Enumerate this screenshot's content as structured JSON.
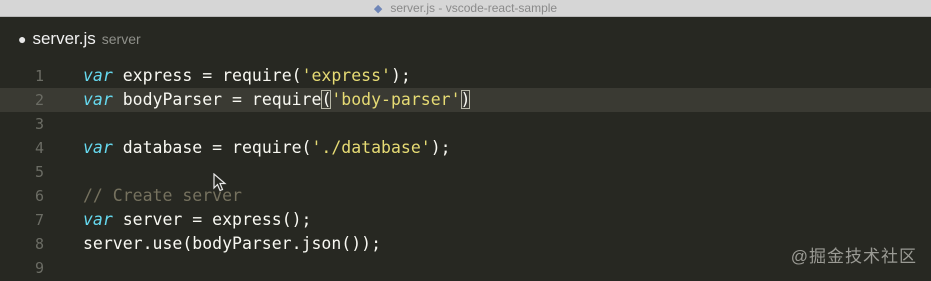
{
  "window": {
    "title": "server.js - vscode-react-sample"
  },
  "tab": {
    "dirty_indicator": "●",
    "filename": "server.js",
    "folder": "server"
  },
  "editor": {
    "lines": [
      {
        "number": "1",
        "tokens": [
          [
            "kw",
            "var"
          ],
          [
            "plain",
            " express = require("
          ],
          [
            "str",
            "'express'"
          ],
          [
            "plain",
            ");"
          ]
        ]
      },
      {
        "number": "2",
        "current": true,
        "tokens": [
          [
            "kw",
            "var"
          ],
          [
            "plain",
            " bodyParser = require"
          ],
          [
            "bracket",
            "("
          ],
          [
            "str",
            "'body-parser'"
          ],
          [
            "bracket",
            ")"
          ]
        ]
      },
      {
        "number": "3",
        "tokens": []
      },
      {
        "number": "4",
        "tokens": [
          [
            "kw",
            "var"
          ],
          [
            "plain",
            " database = require("
          ],
          [
            "str",
            "'./database'"
          ],
          [
            "plain",
            ");"
          ]
        ]
      },
      {
        "number": "5",
        "tokens": []
      },
      {
        "number": "6",
        "tokens": [
          [
            "cmt",
            "// Create server"
          ]
        ]
      },
      {
        "number": "7",
        "tokens": [
          [
            "kw",
            "var"
          ],
          [
            "plain",
            " server = express();"
          ]
        ]
      },
      {
        "number": "8",
        "tokens": [
          [
            "plain",
            "server.use(bodyParser.json());"
          ]
        ]
      },
      {
        "number": "9",
        "tokens": []
      }
    ]
  },
  "watermark": "@掘金技术社区"
}
